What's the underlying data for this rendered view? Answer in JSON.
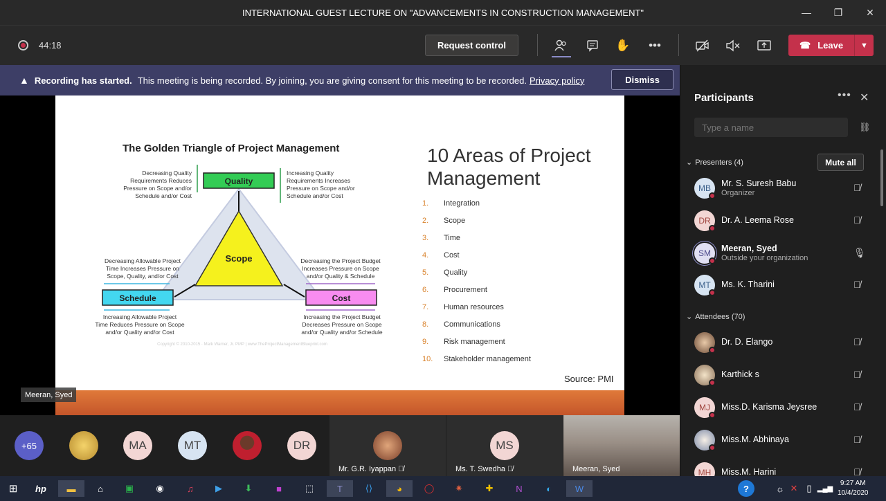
{
  "window": {
    "title": "INTERNATIONAL GUEST LECTURE ON \"ADVANCEMENTS IN CONSTRUCTION MANAGEMENT\""
  },
  "toolbar": {
    "timer": "44:18",
    "request_control": "Request control",
    "leave": "Leave"
  },
  "banner": {
    "heading": "Recording has started.",
    "text": "This meeting is being recorded. By joining, you are giving consent for this meeting to be recorded.",
    "link": "Privacy policy",
    "dismiss": "Dismiss"
  },
  "slide": {
    "left_title": "The Golden Triangle of Project Management",
    "quality": "Quality",
    "scope": "Scope",
    "schedule": "Schedule",
    "cost": "Cost",
    "note_quality_left": [
      "Decreasing Quality",
      "Requirements Reduces",
      "Pressure on Scope and/or",
      "Schedule and/or Cost"
    ],
    "note_quality_right": [
      "Increasing Quality",
      "Requirements Increases",
      "Pressure on Scope and/or",
      "Schedule and/or Cost"
    ],
    "note_schedule_top": [
      "Decreasing Allowable Project",
      "Time Increases Pressure on",
      "Scope, Quality, and/or Cost"
    ],
    "note_schedule_bottom": [
      "Increasing Allowable Project",
      "Time Reduces Pressure on Scope",
      "and/or Quality and/or Cost"
    ],
    "note_cost_top": [
      "Decreasing the Project Budget",
      "Increases Pressure on Scope",
      "and/or Quality & Schedule"
    ],
    "note_cost_bottom": [
      "Increasing the Project Budget",
      "Decreases Pressure on Scope",
      "and/or Quality and/or Schedule"
    ],
    "copyright": "Copyright © 2010-2015 · Mark Warner, Jr. PMP  |  www.TheProjectManagementBlueprint.com",
    "right_title_1": "10 Areas of Project",
    "right_title_2": "Management",
    "areas": [
      {
        "n": "1.",
        "label": "Integration"
      },
      {
        "n": "2.",
        "label": "Scope"
      },
      {
        "n": "3.",
        "label": "Time"
      },
      {
        "n": "4.",
        "label": "Cost"
      },
      {
        "n": "5.",
        "label": "Quality"
      },
      {
        "n": "6.",
        "label": "Procurement"
      },
      {
        "n": "7.",
        "label": "Human resources"
      },
      {
        "n": "8.",
        "label": "Communications"
      },
      {
        "n": "9.",
        "label": "Risk management"
      },
      {
        "n": "10.",
        "label": "Stakeholder management"
      }
    ],
    "source": "Source: PMI"
  },
  "speaker_tag": "Meeran, Syed",
  "strip": {
    "overflow": "+65",
    "avatars": [
      "MA",
      "MT",
      "DR"
    ],
    "tiles": [
      {
        "name": "Mr. G.R. Iyappan"
      },
      {
        "name": "Ms. T. Swedha",
        "initials": "MS"
      },
      {
        "name": "Meeran, Syed"
      }
    ]
  },
  "panel": {
    "title": "Participants",
    "search_placeholder": "Type a name",
    "presenters_label": "Presenters (4)",
    "mute_all": "Mute all",
    "attendees_label": "Attendees (70)",
    "presenters": [
      {
        "initials": "MB",
        "name": "Mr. S. Suresh Babu",
        "sub": "Organizer"
      },
      {
        "initials": "DR",
        "name": "Dr. A. Leema Rose",
        "sub": ""
      },
      {
        "initials": "SM",
        "name": "Meeran, Syed",
        "sub": "Outside your organization"
      },
      {
        "initials": "MT",
        "name": "Ms. K. Tharini",
        "sub": ""
      }
    ],
    "attendees": [
      {
        "initials": "",
        "name": "Dr. D. Elango"
      },
      {
        "initials": "",
        "name": "Karthick s"
      },
      {
        "initials": "MJ",
        "name": "Miss.D. Karisma Jeysree"
      },
      {
        "initials": "",
        "name": "Miss.M. Abhinaya"
      },
      {
        "initials": "MH",
        "name": "Miss.M. Harini"
      }
    ]
  },
  "taskbar": {
    "time": "9:27 AM",
    "date": "10/4/2020"
  },
  "colors": {
    "leave": "#c4314b",
    "banner": "#3d3e66",
    "accent_blue": "#6264a7",
    "slide_band": "#c4552a"
  }
}
